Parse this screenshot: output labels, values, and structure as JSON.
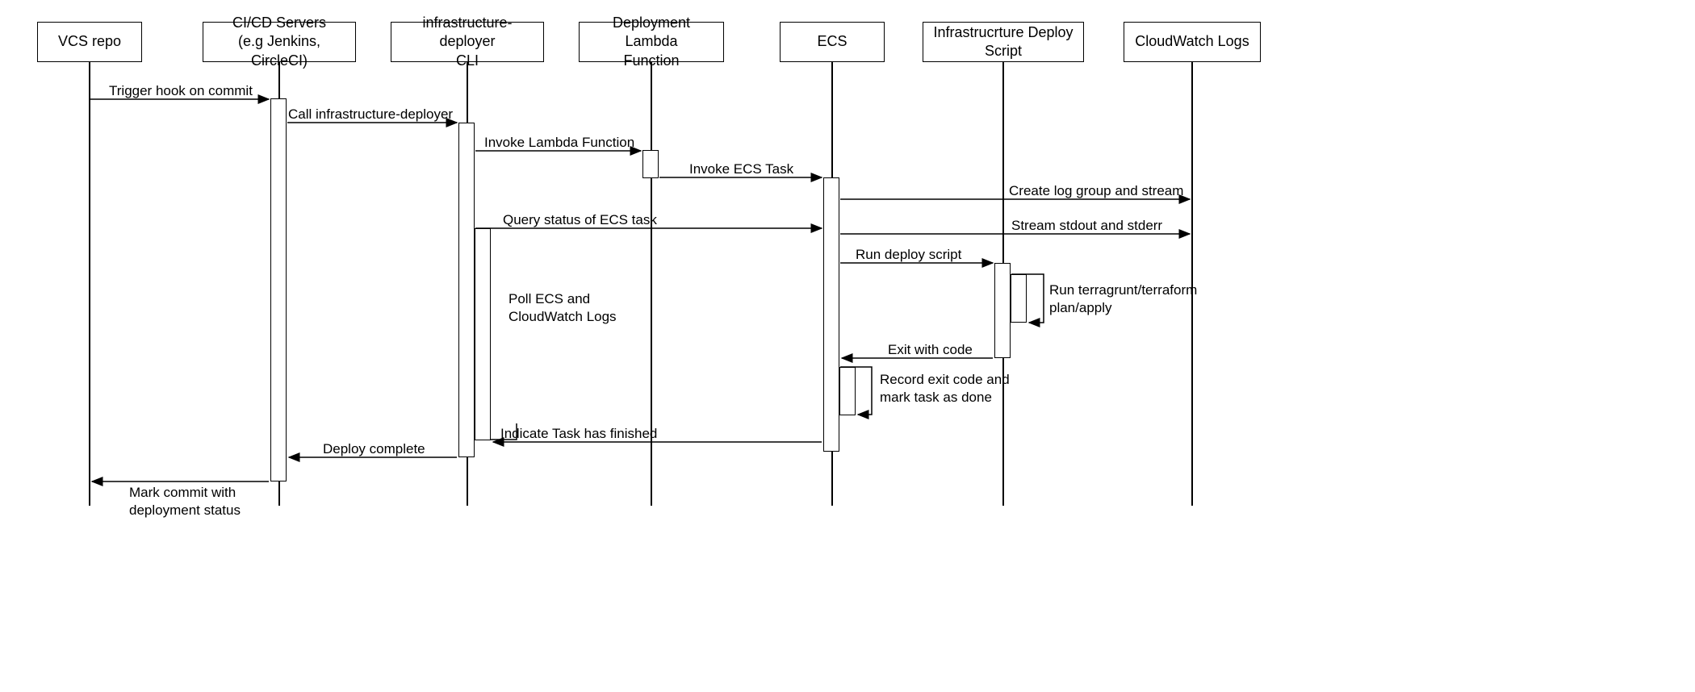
{
  "participants": {
    "p0": "VCS repo",
    "p1": "CI/CD Servers\n(e.g Jenkins, CircleCI)",
    "p2": "infrastructure-deployer\nCLI",
    "p3": "Deployment Lambda\nFunction",
    "p4": "ECS",
    "p5": "Infrastrucrture Deploy\nScript",
    "p6": "CloudWatch Logs"
  },
  "messages": {
    "m0": "Trigger hook on commit",
    "m1": "Call infrastructure-deployer",
    "m2": "Invoke Lambda Function",
    "m3": "Invoke ECS Task",
    "m4": "Query status of ECS task",
    "m5": "Create log group and stream",
    "m6": "Stream stdout and stderr",
    "m7": "Run deploy script",
    "m8": "Poll ECS and\nCloudWatch Logs",
    "m9": "Run terragrunt/terraform\nplan/apply",
    "m10": "Exit with code",
    "m11": "Record exit code and\nmark task as done",
    "m12": "Indicate Task has finished",
    "m13": "Deploy complete",
    "m14": "Mark commit with\ndeployment status"
  }
}
